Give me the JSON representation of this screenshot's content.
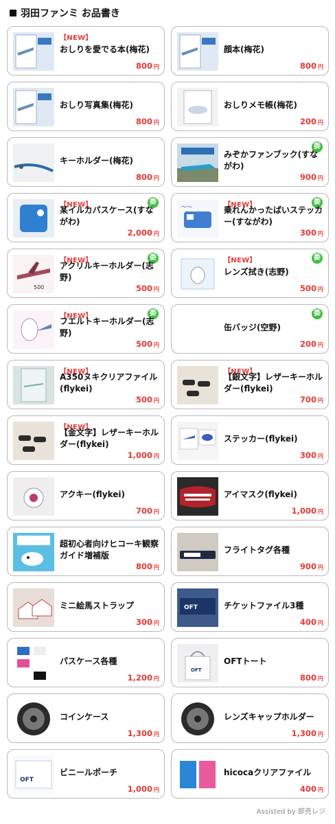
{
  "header": {
    "title": "羽田ファンミ お品書き"
  },
  "price_suffix": "円",
  "consign_label": "委",
  "new_label": "【NEW】",
  "footer": {
    "text": "Assisted by 即売レジ"
  },
  "colors": {
    "accent": "#e53935",
    "consign_badge": "#3fbf3f",
    "card_border": "#b8b8b8"
  },
  "items": [
    {
      "name": "おしりを愛でる本(梅花)",
      "price": "800",
      "is_new": true,
      "consign": false,
      "thumb": "book-photo"
    },
    {
      "name": "顔本(梅花)",
      "price": "800",
      "is_new": false,
      "consign": false,
      "thumb": "book-photo"
    },
    {
      "name": "おしり写真集(梅花)",
      "price": "800",
      "is_new": false,
      "consign": false,
      "thumb": "book-photo"
    },
    {
      "name": "おしりメモ帳(梅花)",
      "price": "200",
      "is_new": false,
      "consign": false,
      "thumb": "memo-photo"
    },
    {
      "name": "キーホルダー(梅花)",
      "price": "800",
      "is_new": false,
      "consign": false,
      "thumb": "strap-photo"
    },
    {
      "name": "みぞかファンブック(すながわ)",
      "price": "900",
      "is_new": false,
      "consign": true,
      "thumb": "train-photo"
    },
    {
      "name": "某イルカパスケース(すながわ)",
      "price": "2,000",
      "is_new": true,
      "consign": true,
      "thumb": "passcase-photo"
    },
    {
      "name": "乗れんかったばいステッカー(すながわ)",
      "price": "300",
      "is_new": true,
      "consign": true,
      "thumb": "bus-illust"
    },
    {
      "name": "アクリルキーホルダー(志野)",
      "price": "500",
      "is_new": true,
      "consign": true,
      "thumb": "plane-illust"
    },
    {
      "name": "レンズ拭き(志野)",
      "price": "500",
      "is_new": true,
      "consign": true,
      "thumb": "cloth-illust"
    },
    {
      "name": "フエルトキーホルダー(志野)",
      "price": "500",
      "is_new": true,
      "consign": true,
      "thumb": "felt-illust"
    },
    {
      "name": "缶バッジ(空野)",
      "price": "200",
      "is_new": false,
      "consign": true,
      "thumb": "none"
    },
    {
      "name": "A350ヌキクリアファイル(flykei)",
      "price": "500",
      "is_new": true,
      "consign": false,
      "thumb": "file-photo"
    },
    {
      "name": "【銀文字】レザーキーホルダー(flykei)",
      "price": "700",
      "is_new": true,
      "consign": false,
      "thumb": "leather-photo"
    },
    {
      "name": "【金文字】レザーキーホルダー(flykei)",
      "price": "1,000",
      "is_new": true,
      "consign": false,
      "thumb": "leather-photo"
    },
    {
      "name": "ステッカー(flykei)",
      "price": "300",
      "is_new": false,
      "consign": false,
      "thumb": "sticker-photo"
    },
    {
      "name": "アクキー(flykei)",
      "price": "700",
      "is_new": false,
      "consign": false,
      "thumb": "acrylic-photo"
    },
    {
      "name": "アイマスク(flykei)",
      "price": "1,000",
      "is_new": false,
      "consign": false,
      "thumb": "eyemask-photo"
    },
    {
      "name": "超初心者向けヒコーキ観察ガイド増補版",
      "price": "800",
      "is_new": false,
      "consign": false,
      "thumb": "guide-illust"
    },
    {
      "name": "フライトタグ各種",
      "price": "900",
      "is_new": false,
      "consign": false,
      "thumb": "tag-photo"
    },
    {
      "name": "ミニ絵馬ストラップ",
      "price": "300",
      "is_new": false,
      "consign": false,
      "thumb": "ema-photo"
    },
    {
      "name": "チケットファイル3種",
      "price": "400",
      "is_new": false,
      "consign": false,
      "thumb": "ticket-photo"
    },
    {
      "name": "パスケース各種",
      "price": "1,200",
      "is_new": false,
      "consign": false,
      "thumb": "passcases-photo"
    },
    {
      "name": "OFTトート",
      "price": "800",
      "is_new": false,
      "consign": false,
      "thumb": "tote-photo"
    },
    {
      "name": "コインケース",
      "price": "1,300",
      "is_new": false,
      "consign": false,
      "thumb": "engine-photo"
    },
    {
      "name": "レンズキャップホルダー",
      "price": "1,300",
      "is_new": false,
      "consign": false,
      "thumb": "engine-photo"
    },
    {
      "name": "ビニールポーチ",
      "price": "1,000",
      "is_new": false,
      "consign": false,
      "thumb": "pouch-photo"
    },
    {
      "name": "hicocaクリアファイル",
      "price": "400",
      "is_new": false,
      "consign": false,
      "thumb": "hicoca-photo"
    }
  ]
}
